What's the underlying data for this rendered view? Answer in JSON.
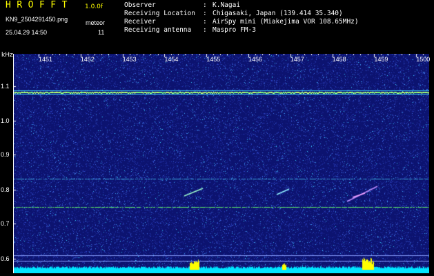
{
  "header": {
    "app_title": "HROFFT",
    "version": "1.0.0f",
    "filename": "KN9_2504291450.png",
    "mode": "meteor",
    "timestamp": "25.04.29 14:50",
    "count": "11",
    "info": [
      {
        "key": "Observer",
        "value": "K.Nagai"
      },
      {
        "key": "Receiving Location",
        "value": "Chigasaki, Japan (139.414 35.340)"
      },
      {
        "key": "Receiver",
        "value": "AirSpy mini (Miakejima VOR 108.65MHz)"
      },
      {
        "key": "Receiving antenna",
        "value": "Maspro FM-3"
      }
    ]
  },
  "spectrogram": {
    "y_unit": "kHz",
    "y_ticks": [
      "1.1",
      "1.0",
      "0.9",
      "0.8",
      "0.7",
      "0.6"
    ],
    "x_ticks": [
      "1451",
      "1452",
      "1453",
      "1454",
      "1455",
      "1456",
      "1457",
      "1458",
      "1459",
      "1500"
    ],
    "colors": {
      "background": "#0c1370",
      "carrier": "#7fff7f",
      "noise_floor": "#00e5ff"
    }
  }
}
